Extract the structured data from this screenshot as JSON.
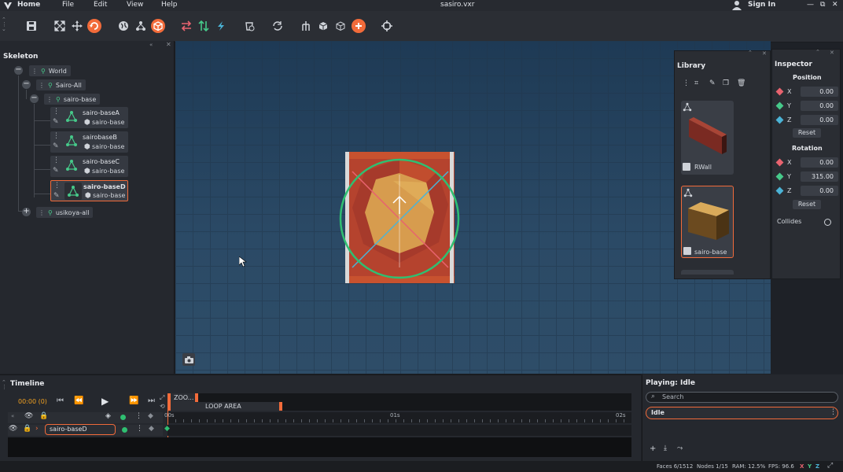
{
  "titlebar": {
    "home": "Home",
    "menu": [
      "File",
      "Edit",
      "View",
      "Help"
    ],
    "file_title": "sasiro.vxr",
    "sign_in": "Sign In"
  },
  "toolbar": {
    "icons": [
      "save-icon",
      "fit-view-icon",
      "move-icon",
      "refresh-icon",
      "globe-icon",
      "hierarchy-icon",
      "cube-orange-icon",
      "swap-icon",
      "sort-icon",
      "flash-icon",
      "bucket-icon",
      "loop-icon",
      "tree-icon",
      "cube-icon",
      "wire-cube-icon",
      "add-icon",
      "target-icon"
    ]
  },
  "skeleton": {
    "title": "Skeleton",
    "world": "World",
    "sairo_all": "Sairo-All",
    "sairo_base": "sairo-base",
    "children": [
      {
        "name": "sairo-baseA",
        "mesh": "sairo-base"
      },
      {
        "name": "sairobaseB",
        "mesh": "sairo-base"
      },
      {
        "name": "sairo-baseC",
        "mesh": "sairo-base"
      },
      {
        "name": "sairo-baseD",
        "mesh": "sairo-base"
      }
    ],
    "usikoya": "usikoya-all"
  },
  "library": {
    "title": "Library",
    "items": [
      {
        "name": "RWall"
      },
      {
        "name": "sairo-base"
      }
    ]
  },
  "inspector": {
    "title": "Inspector",
    "position_label": "Position",
    "position": {
      "x": "0.00",
      "y": "0.00",
      "z": "0.00"
    },
    "rotation_label": "Rotation",
    "rotation": {
      "x": "0.00",
      "y": "315.00",
      "z": "0.00"
    },
    "reset": "Reset",
    "collides": "Collides",
    "axis": {
      "x": "X",
      "y": "Y",
      "z": "Z"
    },
    "colors": {
      "x": "#e8636f",
      "y": "#46c98a",
      "z": "#4bb3d6"
    }
  },
  "timeline": {
    "title": "Timeline",
    "time": "00:00 (0)",
    "zoom_label": "ZOO...",
    "loop_label": "LOOP AREA",
    "ticks": [
      "00s",
      "01s",
      "02s"
    ],
    "track_name": "sairo-baseD"
  },
  "playing": {
    "title": "Playing: Idle",
    "search_placeholder": "Search",
    "animation": "Idle"
  },
  "status": {
    "faces": "Faces 6/1512",
    "nodes": "Nodes 1/15",
    "ram": "RAM: 12.5%",
    "fps": "FPS: 96.6",
    "axes": [
      "X",
      "Y",
      "Z"
    ]
  },
  "accent": "#f26b3a"
}
